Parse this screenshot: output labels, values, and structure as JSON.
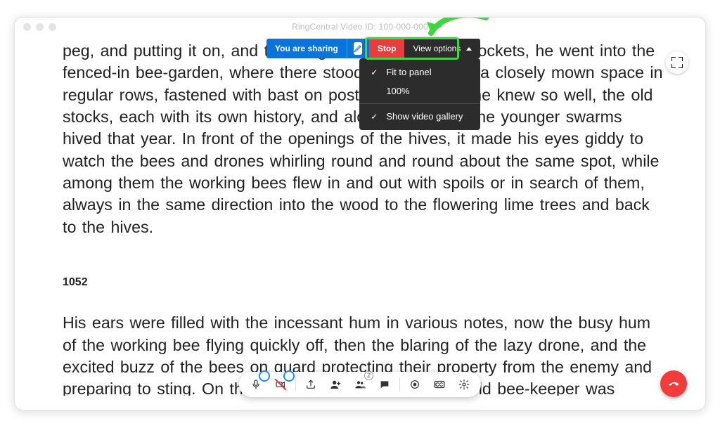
{
  "window": {
    "title": "RingCentral Video ID: 100-000-000"
  },
  "share_bar": {
    "sharing_label": "You are sharing",
    "stop_label": "Stop",
    "view_options_label": "View options",
    "dropdown": {
      "fit_to_panel": {
        "label": "Fit to panel",
        "checked": true
      },
      "zoom_100": {
        "label": "100%",
        "checked": false
      },
      "show_gallery": {
        "label": "Show video gallery",
        "checked": true
      }
    }
  },
  "document": {
    "para1": "peg, and putting it on, and thrusting his hands into his pockets, he went into the fenced-in bee-garden, where there stood in the midst of a closely mown space in regular rows, fastened with bast on posts, all the hives he knew so well, the old stocks, each with its own history, and along the fences the younger swarms hived that year. In front of the openings of the hives, it made his eyes giddy to watch the bees and drones whirling round and round about the same spot, while among them the working bees flew in and out with spoils or in search of them, always in the same direction into the wood to the flowering lime trees and back to the hives.",
    "page_number": "1052",
    "para2": "His ears were filled with the incessant hum in various notes, now the busy hum of the working bee flying quickly off, then the blaring of the lazy drone, and the excited buzz of the bees on guard protecting their property from the enemy and preparing to sting. On the farther side of the fence the old bee-keeper was shaving a hoop for a tub, and he did not"
  },
  "participants_count": "2",
  "colors": {
    "primary_blue": "#0a74db",
    "stop_red": "#e63e3e",
    "highlight_green": "#3fd63f",
    "hangup_red": "#f23b3b"
  }
}
